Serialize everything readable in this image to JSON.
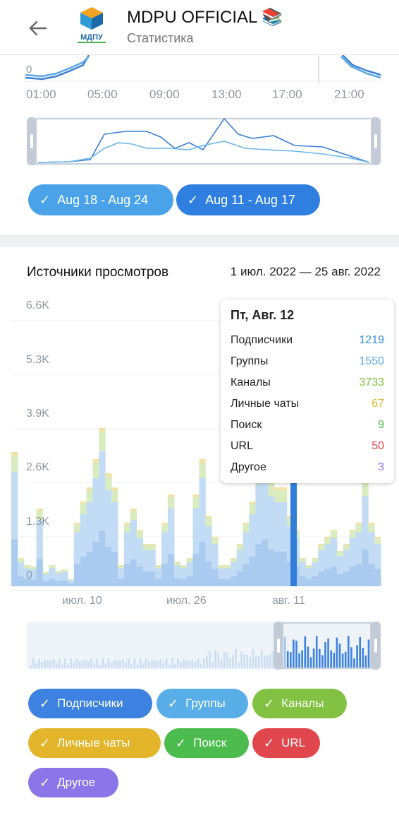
{
  "header": {
    "title": "MDPU OFFICIAL 📚",
    "subtitle": "Статистика",
    "avatar_text": "МДПУ"
  },
  "top_chart": {
    "zero_label": "0",
    "x_labels": [
      "01:00",
      "05:00",
      "09:00",
      "13:00",
      "17:00",
      "21:00"
    ]
  },
  "period_chips": [
    {
      "label": "Aug 18 - Aug 24",
      "color": "#4aa3e8"
    },
    {
      "label": "Aug 11 - Aug 17",
      "color": "#2f7fe0"
    }
  ],
  "sources": {
    "title": "Источники просмотров",
    "range": "1 июл. 2022 — 25 авг. 2022",
    "y_labels": [
      "6.6K",
      "5.3K",
      "3.9K",
      "2.6K",
      "1.3K",
      "0"
    ],
    "x_labels": [
      "июл. 10",
      "июл. 26",
      "авг. 11"
    ],
    "tooltip": {
      "date": "Пт, Авг. 12",
      "rows": [
        {
          "label": "Подписчики",
          "value": "1219",
          "color": "#3d8ee0"
        },
        {
          "label": "Группы",
          "value": "1550",
          "color": "#5fa9e6"
        },
        {
          "label": "Каналы",
          "value": "3733",
          "color": "#82c03f"
        },
        {
          "label": "Личные чаты",
          "value": "67",
          "color": "#e0b623"
        },
        {
          "label": "Поиск",
          "value": "9",
          "color": "#4fbf4f"
        },
        {
          "label": "URL",
          "value": "50",
          "color": "#e0474c"
        },
        {
          "label": "Другое",
          "value": "3",
          "color": "#8a76e8"
        }
      ]
    },
    "chips": [
      {
        "label": "Подписчики",
        "color": "#3d82e0"
      },
      {
        "label": "Группы",
        "color": "#5aaee8"
      },
      {
        "label": "Каналы",
        "color": "#83c142"
      },
      {
        "label": "Личные чаты",
        "color": "#e3b52a"
      },
      {
        "label": "Поиск",
        "color": "#4cbc4f"
      },
      {
        "label": "URL",
        "color": "#e0474c"
      },
      {
        "label": "Другое",
        "color": "#8a76e8"
      }
    ]
  }
}
